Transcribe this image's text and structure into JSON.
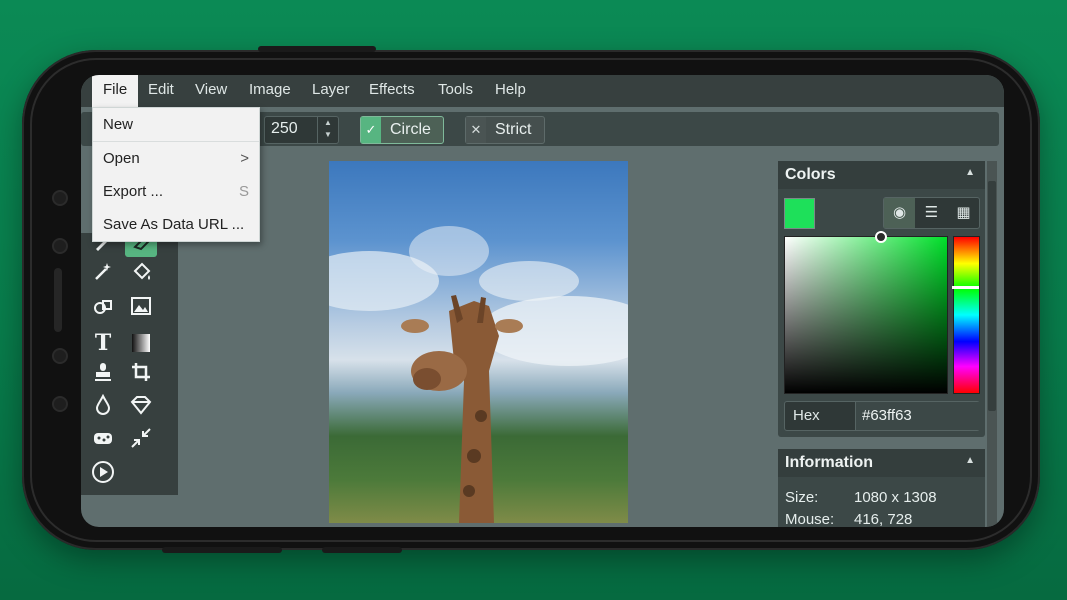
{
  "menubar": {
    "items": [
      "File",
      "Edit",
      "View",
      "Image",
      "Layer",
      "Effects",
      "Tools",
      "Help"
    ],
    "active": "File"
  },
  "file_menu": {
    "items": [
      {
        "label": "New",
        "shortcut": ""
      },
      {
        "label": "Open",
        "shortcut": ">"
      },
      {
        "label": "Export ...",
        "shortcut": "S"
      },
      {
        "label": "Save As Data URL ...",
        "shortcut": ""
      }
    ]
  },
  "toolbar": {
    "size_value": "250",
    "circle_label": "Circle",
    "circle_checked": true,
    "strict_label": "Strict",
    "strict_checked": false
  },
  "tools": {
    "icons": [
      "pencil-icon",
      "eraser-icon",
      "magic-wand-icon",
      "fill-bucket-icon",
      "shapes-icon",
      "image-icon",
      "text-icon",
      "gradient-icon",
      "clone-stamp-icon",
      "crop-icon",
      "blur-drop-icon",
      "sharpen-icon",
      "sponge-icon",
      "shrink-icon",
      "play-icon"
    ],
    "text_tool_glyph": "T"
  },
  "colors_panel": {
    "title": "Colors",
    "swatch_color": "#1ee05a",
    "hex_label": "Hex",
    "hex_value": "#63ff63"
  },
  "info_panel": {
    "title": "Information",
    "size_label": "Size:",
    "size_value": "1080 x 1308",
    "mouse_label": "Mouse:",
    "mouse_value": "416, 728"
  },
  "theme": {
    "accent": "#57b581",
    "background": "#0b8a55",
    "panel": "#3c4847"
  }
}
